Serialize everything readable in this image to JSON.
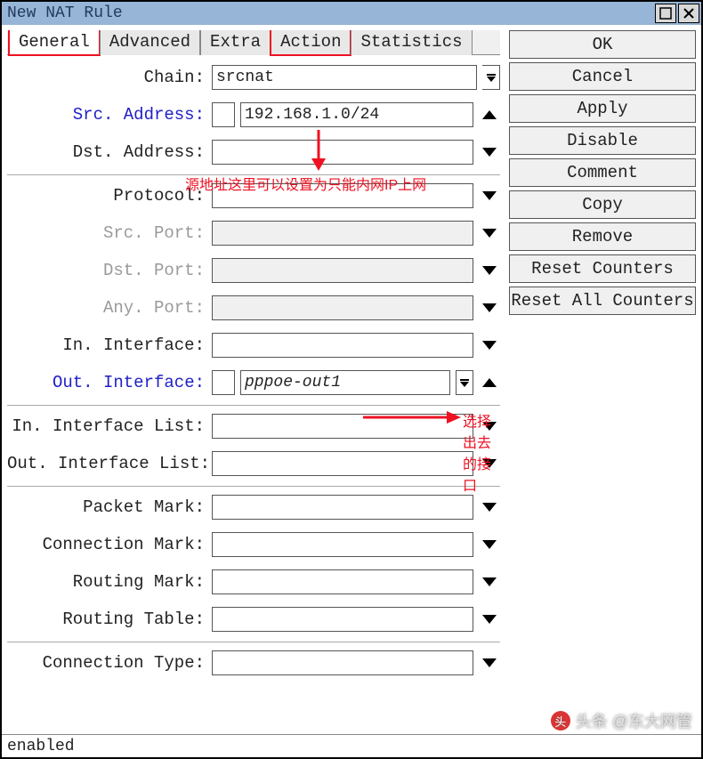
{
  "window": {
    "title": "New NAT Rule"
  },
  "tabs": [
    {
      "label": "General",
      "active": true,
      "boxed": true
    },
    {
      "label": "Advanced",
      "active": false,
      "boxed": false
    },
    {
      "label": "Extra",
      "active": false,
      "boxed": false
    },
    {
      "label": "Action",
      "active": false,
      "boxed": true
    },
    {
      "label": "Statistics",
      "active": false,
      "boxed": false
    }
  ],
  "form": {
    "chain": {
      "label": "Chain:",
      "value": "srcnat"
    },
    "src_address": {
      "label": "Src. Address:",
      "value": "192.168.1.0/24"
    },
    "dst_address": {
      "label": "Dst. Address:",
      "value": ""
    },
    "protocol": {
      "label": "Protocol:",
      "value": ""
    },
    "src_port": {
      "label": "Src. Port:",
      "value": ""
    },
    "dst_port": {
      "label": "Dst. Port:",
      "value": ""
    },
    "any_port": {
      "label": "Any. Port:",
      "value": ""
    },
    "in_interface": {
      "label": "In. Interface:",
      "value": ""
    },
    "out_interface": {
      "label": "Out. Interface:",
      "value": "pppoe-out1"
    },
    "in_interface_list": {
      "label": "In. Interface List:",
      "value": ""
    },
    "out_interface_list": {
      "label": "Out. Interface List:",
      "value": ""
    },
    "packet_mark": {
      "label": "Packet Mark:",
      "value": ""
    },
    "connection_mark": {
      "label": "Connection Mark:",
      "value": ""
    },
    "routing_mark": {
      "label": "Routing Mark:",
      "value": ""
    },
    "routing_table": {
      "label": "Routing Table:",
      "value": ""
    },
    "connection_type": {
      "label": "Connection Type:",
      "value": ""
    }
  },
  "buttons": {
    "ok": "OK",
    "cancel": "Cancel",
    "apply": "Apply",
    "disable": "Disable",
    "comment": "Comment",
    "copy": "Copy",
    "remove": "Remove",
    "reset_counters": "Reset Counters",
    "reset_all_counters": "Reset All Counters"
  },
  "status": "enabled",
  "annotations": {
    "src_note": "源地址这里可以设置为只能内网IP上网",
    "out_note": "选择出去的接口"
  },
  "watermark": "头条 @东大网管"
}
